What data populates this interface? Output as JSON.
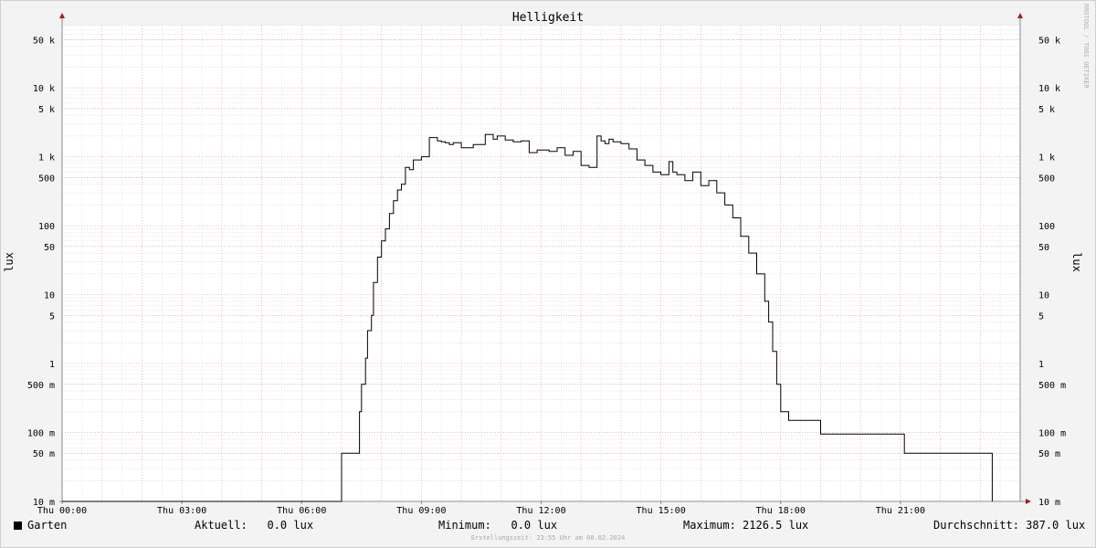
{
  "chart_data": {
    "type": "line",
    "title": "Helligkeit",
    "ylabel": "lux",
    "y_scale": "log",
    "ylim": [
      0.01,
      80000
    ],
    "xlim_hours": [
      0,
      24
    ],
    "y_ticks": [
      {
        "value": 0.01,
        "label": "10 m"
      },
      {
        "value": 0.05,
        "label": "50 m"
      },
      {
        "value": 0.1,
        "label": "100 m"
      },
      {
        "value": 0.5,
        "label": "500 m"
      },
      {
        "value": 1,
        "label": "1"
      },
      {
        "value": 5,
        "label": "5"
      },
      {
        "value": 10,
        "label": "10"
      },
      {
        "value": 50,
        "label": "50"
      },
      {
        "value": 100,
        "label": "100"
      },
      {
        "value": 500,
        "label": "500"
      },
      {
        "value": 1000,
        "label": "1 k"
      },
      {
        "value": 5000,
        "label": "5 k"
      },
      {
        "value": 10000,
        "label": "10 k"
      },
      {
        "value": 50000,
        "label": "50 k"
      }
    ],
    "x_ticks": [
      {
        "hour": 0,
        "label": "Thu 00:00"
      },
      {
        "hour": 3,
        "label": "Thu 03:00"
      },
      {
        "hour": 6,
        "label": "Thu 06:00"
      },
      {
        "hour": 9,
        "label": "Thu 09:00"
      },
      {
        "hour": 12,
        "label": "Thu 12:00"
      },
      {
        "hour": 15,
        "label": "Thu 15:00"
      },
      {
        "hour": 18,
        "label": "Thu 18:00"
      },
      {
        "hour": 21,
        "label": "Thu 21:00"
      }
    ],
    "grid": true,
    "series": [
      {
        "name": "Garten",
        "color": "#000000",
        "x_hours": [
          0,
          6.9,
          7.0,
          7.1,
          7.3,
          7.45,
          7.5,
          7.6,
          7.65,
          7.75,
          7.8,
          7.9,
          8.0,
          8.1,
          8.2,
          8.3,
          8.4,
          8.5,
          8.6,
          8.7,
          8.8,
          9.0,
          9.2,
          9.4,
          9.5,
          9.6,
          9.7,
          9.8,
          10.0,
          10.3,
          10.6,
          10.8,
          10.9,
          11.1,
          11.3,
          11.5,
          11.7,
          11.9,
          12.2,
          12.4,
          12.6,
          12.8,
          13.0,
          13.2,
          13.4,
          13.5,
          13.6,
          13.7,
          13.8,
          14.0,
          14.2,
          14.4,
          14.6,
          14.8,
          15.0,
          15.2,
          15.3,
          15.4,
          15.6,
          15.8,
          16.0,
          16.2,
          16.4,
          16.6,
          16.8,
          17.0,
          17.2,
          17.4,
          17.6,
          17.7,
          17.8,
          17.9,
          18.0,
          18.2,
          18.8,
          18.9,
          19.0,
          19.5,
          20.5,
          21.0,
          21.1,
          21.5,
          22.0,
          22.5,
          23.0,
          23.2,
          23.3
        ],
        "y_lux": [
          0.01,
          0.01,
          0.05,
          0.05,
          0.05,
          0.2,
          0.5,
          1.2,
          3,
          5,
          15,
          35,
          60,
          90,
          150,
          230,
          330,
          400,
          700,
          650,
          900,
          1000,
          1900,
          1700,
          1650,
          1600,
          1500,
          1600,
          1350,
          1500,
          2100,
          1800,
          2000,
          1750,
          1650,
          1700,
          1150,
          1250,
          1200,
          1350,
          1050,
          1200,
          750,
          700,
          2000,
          1700,
          1550,
          1800,
          1650,
          1550,
          1300,
          900,
          750,
          600,
          550,
          850,
          600,
          550,
          450,
          600,
          380,
          450,
          300,
          200,
          130,
          70,
          40,
          20,
          8,
          4,
          1.5,
          0.5,
          0.2,
          0.15,
          0.15,
          0.15,
          0.095,
          0.095,
          0.095,
          0.095,
          0.05,
          0.05,
          0.05,
          0.05,
          0.05,
          0.05,
          0.01
        ]
      }
    ]
  },
  "legend": {
    "series_label": "Garten",
    "aktuell_label": "Aktuell:",
    "aktuell_value": "0.0 lux",
    "minimum_label": "Minimum:",
    "minimum_value": "0.0 lux",
    "maximum_label": "Maximum:",
    "maximum_value": "2126.5 lux",
    "durchschnitt_label": "Durchschnitt:",
    "durchschnitt_value": "387.0 lux"
  },
  "footer": "Erstellungszeit: 23:55 Uhr am 08.02.2024",
  "watermark": "RRDTOOL / TOBI OETIKER"
}
